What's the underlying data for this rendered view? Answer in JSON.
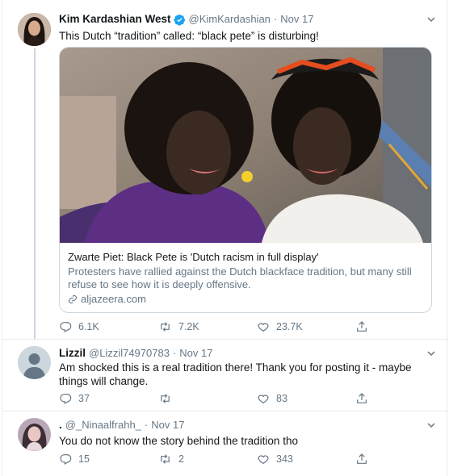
{
  "tweets": [
    {
      "name": "Kim Kardashian West",
      "handle": "@KimKardashian",
      "separator": "·",
      "date": "Nov 17",
      "text": "This Dutch “tradition” called: “black pete” is disturbing!",
      "card": {
        "title": "Zwarte Piet: Black Pete is 'Dutch racism in full display'",
        "description": "Protesters have rallied against the Dutch blackface tradition, but many still refuse to see how it is deeply offensive.",
        "domain": "aljazeera.com"
      },
      "replies": "6.1K",
      "retweets": "7.2K",
      "likes": "23.7K"
    },
    {
      "name": "Lizzil",
      "handle": "@Lizzil74970783",
      "separator": "·",
      "date": "Nov 17",
      "text": "Am shocked this is a real tradition there! Thank you for posting it - maybe things will change.",
      "replies": "37",
      "retweets": "",
      "likes": "83"
    },
    {
      "name": ".",
      "handle": "@_Ninaalfrahh_",
      "separator": "·",
      "date": "Nov 17",
      "text": "You do not know the story behind the tradition tho",
      "replies": "15",
      "retweets": "2",
      "likes": "343"
    }
  ],
  "colors": {
    "text": "#14171a",
    "secondary": "#657786",
    "border": "#e6ecf0",
    "verified": "#1da1f2"
  },
  "icons": [
    "verified-badge-icon",
    "chevron-down-icon",
    "reply-icon",
    "retweet-icon",
    "like-icon",
    "share-icon",
    "link-icon",
    "default-avatar-icon"
  ]
}
